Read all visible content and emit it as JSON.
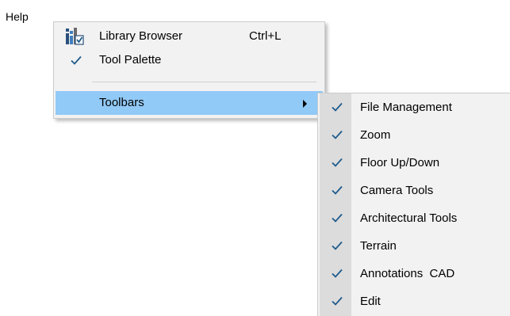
{
  "menubar": {
    "help_label": "Help"
  },
  "view_menu": {
    "items": [
      {
        "label": "Library Browser",
        "shortcut": "Ctrl+L",
        "icon": "library-browser-icon",
        "checked": false
      },
      {
        "label": "Tool Palette",
        "shortcut": "",
        "icon": "checkmark-icon",
        "checked": true
      },
      {
        "label": "Toolbars",
        "shortcut": "",
        "icon": "submenu-arrow-icon",
        "checked": false,
        "highlighted": true
      }
    ]
  },
  "toolbars_submenu": {
    "items": [
      {
        "label": "File Management",
        "checked": true
      },
      {
        "label": "Zoom",
        "checked": true
      },
      {
        "label": "Floor Up/Down",
        "checked": true
      },
      {
        "label": "Camera Tools",
        "checked": true
      },
      {
        "label": "Architectural Tools",
        "checked": true
      },
      {
        "label": "Terrain",
        "checked": true
      },
      {
        "label": "Annotations  CAD",
        "checked": true
      },
      {
        "label": "Edit",
        "checked": true
      }
    ]
  },
  "colors": {
    "menu_background": "#f2f2f2",
    "highlight": "#91c9f7",
    "check_gutter": "#dcdcdc",
    "checkmark": "#1e5a8c"
  }
}
